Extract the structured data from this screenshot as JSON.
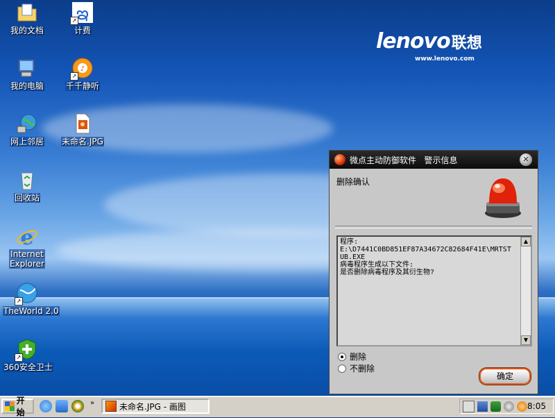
{
  "desktop": {
    "brand": {
      "name": "lenovo",
      "cn": "联想",
      "url": "www.lenovo.com"
    },
    "icons": [
      {
        "label": "我的文档",
        "icon": "folder-docs-icon"
      },
      {
        "label": "计费",
        "icon": "china-telecom-icon"
      },
      {
        "label": "我的电脑",
        "icon": "my-computer-icon"
      },
      {
        "label": "千千静听",
        "icon": "ttplayer-icon"
      },
      {
        "label": "网上邻居",
        "icon": "network-places-icon"
      },
      {
        "label": "未命名.JPG",
        "icon": "jpg-file-icon"
      },
      {
        "label": "回收站",
        "icon": "recycle-bin-icon"
      },
      {
        "label": "Internet Explorer",
        "icon": "internet-explorer-icon"
      },
      {
        "label": "TheWorld 2.0",
        "icon": "theworld-browser-icon"
      },
      {
        "label": "360安全卫士",
        "icon": "360-security-icon"
      }
    ]
  },
  "dialog": {
    "title": "微点主动防御软件   警示信息",
    "section_title": "删除确认",
    "message_lines": [
      "程序:",
      "E:\\D7441C0BD851EF87A34672C82684F41E\\MRTSTUB.EXE",
      "病毒程序生成以下文件:",
      "是否删除病毒程序及其衍生物?"
    ],
    "options": [
      {
        "label": "删除",
        "selected": true
      },
      {
        "label": "不删除",
        "selected": false
      }
    ],
    "ok_label": "确定",
    "accent": "#e05a20"
  },
  "taskbar": {
    "start_label": "开始",
    "task_label": "未命名.JPG - 画图",
    "clock": "8:05"
  }
}
